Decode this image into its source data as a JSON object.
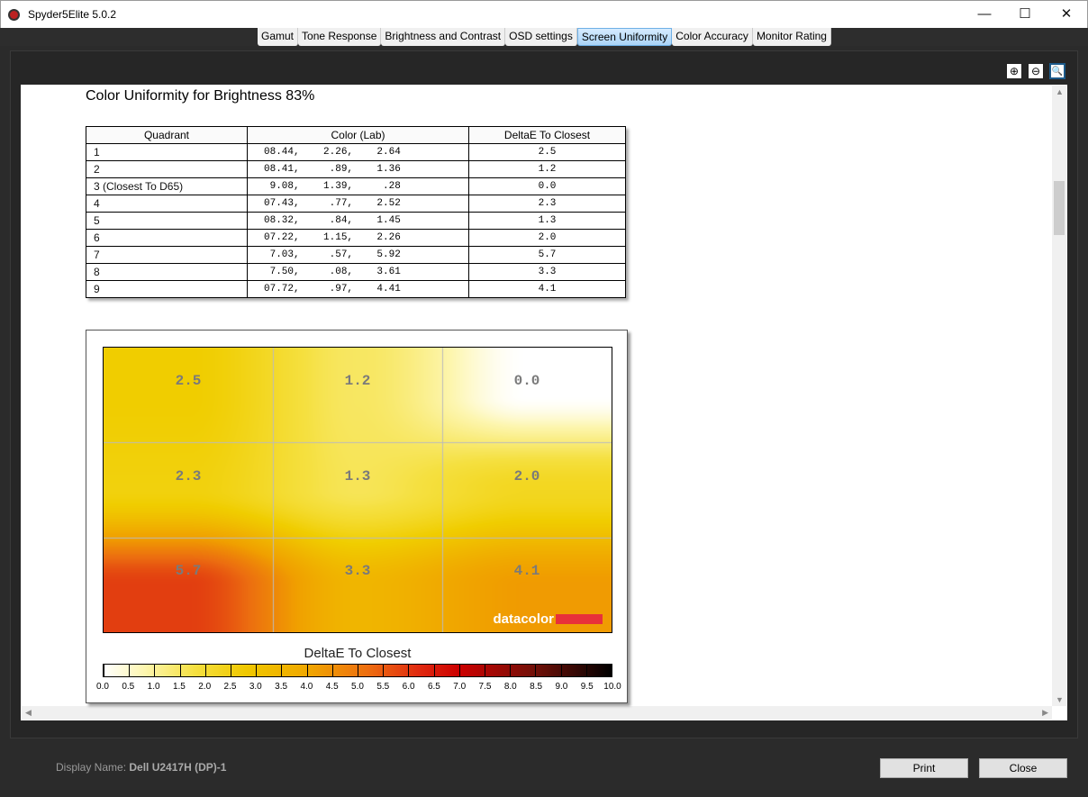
{
  "window": {
    "title": "Spyder5Elite 5.0.2",
    "minimize": "—",
    "maximize": "☐",
    "close": "✕"
  },
  "tabs": [
    {
      "label": "Gamut"
    },
    {
      "label": "Tone Response"
    },
    {
      "label": "Brightness and Contrast"
    },
    {
      "label": "OSD settings"
    },
    {
      "label": "Screen Uniformity",
      "active": true
    },
    {
      "label": "Color Accuracy"
    },
    {
      "label": "Monitor Rating"
    }
  ],
  "zoom_tools": {
    "zoom_in": "⊕",
    "zoom_out": "⊖",
    "zoom_fit": "🔍"
  },
  "report": {
    "title": "Color Uniformity for Brightness 83%",
    "columns": [
      "Quadrant",
      "Color (Lab)",
      "DeltaE To Closest"
    ],
    "rows": [
      {
        "quadrant": "1",
        "lab": "08.44,    2.26,    2.64",
        "de": "2.5"
      },
      {
        "quadrant": "2",
        "lab": "08.41,     .89,    1.36",
        "de": "1.2"
      },
      {
        "quadrant": "3 (Closest To D65)",
        "lab": " 9.08,    1.39,     .28",
        "de": "0.0"
      },
      {
        "quadrant": "4",
        "lab": "07.43,     .77,    2.52",
        "de": "2.3"
      },
      {
        "quadrant": "5",
        "lab": "08.32,     .84,    1.45",
        "de": "1.3"
      },
      {
        "quadrant": "6",
        "lab": "07.22,    1.15,    2.26",
        "de": "2.0"
      },
      {
        "quadrant": "7",
        "lab": " 7.03,     .57,    5.92",
        "de": "5.7"
      },
      {
        "quadrant": "8",
        "lab": " 7.50,     .08,    3.61",
        "de": "3.3"
      },
      {
        "quadrant": "9",
        "lab": "07.72,     .97,    4.41",
        "de": "4.1"
      }
    ]
  },
  "chart_data": {
    "type": "heatmap",
    "grid": [
      [
        2.5,
        1.2,
        0.0
      ],
      [
        2.3,
        1.3,
        2.0
      ],
      [
        5.7,
        3.3,
        4.1
      ]
    ],
    "labels": [
      "2.5",
      "1.2",
      "0.0",
      "2.3",
      "1.3",
      "2.0",
      "5.7",
      "3.3",
      "4.1"
    ],
    "colorbar_title": "DeltaE To Closest",
    "colorbar_range": [
      0,
      10
    ],
    "colorbar_ticks": [
      "0.0",
      "0.5",
      "1.0",
      "1.5",
      "2.0",
      "2.5",
      "3.0",
      "3.5",
      "4.0",
      "4.5",
      "5.0",
      "5.5",
      "6.0",
      "6.5",
      "7.0",
      "7.5",
      "8.0",
      "8.5",
      "9.0",
      "9.5",
      "10.0"
    ],
    "logo": "datacolor"
  },
  "footer": {
    "display_label": "Display Name:",
    "display_value": "Dell U2417H (DP)-1",
    "print": "Print",
    "close": "Close"
  }
}
